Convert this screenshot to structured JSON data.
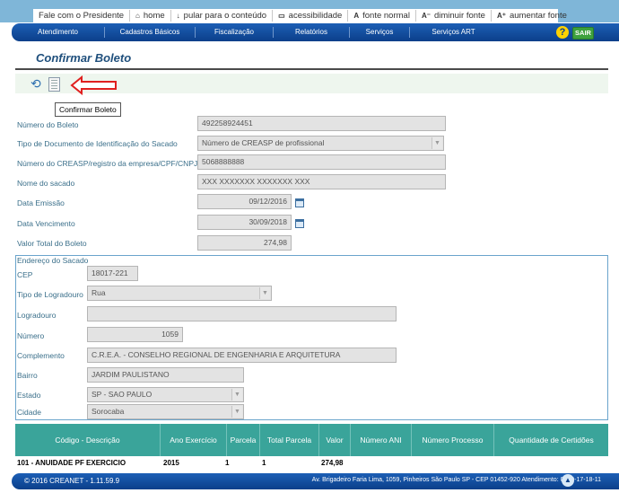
{
  "top_links": [
    {
      "label": "Fale com o Presidente",
      "icon": ""
    },
    {
      "label": "home",
      "icon": "home-icon"
    },
    {
      "label": "pular para o conteúdo",
      "icon": "down-arrow-icon"
    },
    {
      "label": "acessibilidade",
      "icon": "accessibility-icon"
    },
    {
      "label": "fonte normal",
      "icon": "font-icon"
    },
    {
      "label": "diminuir fonte",
      "icon": "font-decrease-icon"
    },
    {
      "label": "aumentar fonte",
      "icon": "font-increase-icon"
    }
  ],
  "nav": [
    "Atendimento",
    "Cadastros Básicos",
    "Fiscalização",
    "Relatórios",
    "Serviços",
    "Serviços ART"
  ],
  "header": {
    "help": "?",
    "sair": "SAIR"
  },
  "page_title": "Confirmar Boleto",
  "tooltip": "Confirmar Boleto",
  "form": {
    "numero_boleto": {
      "label": "Número do Boleto",
      "value": "492258924451"
    },
    "tipo_documento": {
      "label": "Tipo de Documento de Identificação do Sacado",
      "value": "Número de CREASP de profissional"
    },
    "numero_creasp": {
      "label": "Número do CREASP/registro da empresa/CPF/CNPJ",
      "value": "5068888888"
    },
    "nome_sacado": {
      "label": "Nome do sacado",
      "value": "XXX XXXXXXX XXXXXXX XXX"
    },
    "data_emissao": {
      "label": "Data Emissão",
      "value": "09/12/2016"
    },
    "data_vencimento": {
      "label": "Data Vencimento",
      "value": "30/09/2018"
    },
    "valor_total": {
      "label": "Valor Total do Boleto",
      "value": "274,98"
    }
  },
  "address": {
    "title": "Endereço do Sacado",
    "cep": {
      "label": "CEP",
      "value": "18017-221"
    },
    "tipo_logradouro": {
      "label": "Tipo de Logradouro",
      "value": "Rua"
    },
    "logradouro": {
      "label": "Logradouro",
      "value": ""
    },
    "numero": {
      "label": "Número",
      "value": "1059"
    },
    "complemento": {
      "label": "Complemento",
      "value": "C.R.E.A. - CONSELHO REGIONAL DE ENGENHARIA E ARQUITETURA"
    },
    "bairro": {
      "label": "Bairro",
      "value": "JARDIM PAULISTANO"
    },
    "estado": {
      "label": "Estado",
      "value": "SP - SAO PAULO"
    },
    "cidade": {
      "label": "Cidade",
      "value": "Sorocaba"
    }
  },
  "table": {
    "headers": [
      "Código - Descrição",
      "Ano Exercício",
      "Parcela",
      "Total Parcela",
      "Valor",
      "Número ANI",
      "Número Processo",
      "Quantidade de Certidões"
    ],
    "rows": [
      [
        "101 - ANUIDADE PF EXERCICIO",
        "2015",
        "1",
        "1",
        "274,98",
        "",
        "",
        ""
      ]
    ]
  },
  "footer": {
    "left": "© 2016 CREANET - 1.11.59.9",
    "right": "Av. Brigadeiro Faria Lima, 1059, Pinheiros São Paulo SP - CEP 01452-920 Atendimento: 0800-17-18-11"
  },
  "colors": {
    "nav": "#1d5fb5",
    "table_header": "#3aa49a",
    "label": "#3a6f8a",
    "arrow": "#e0201f"
  }
}
